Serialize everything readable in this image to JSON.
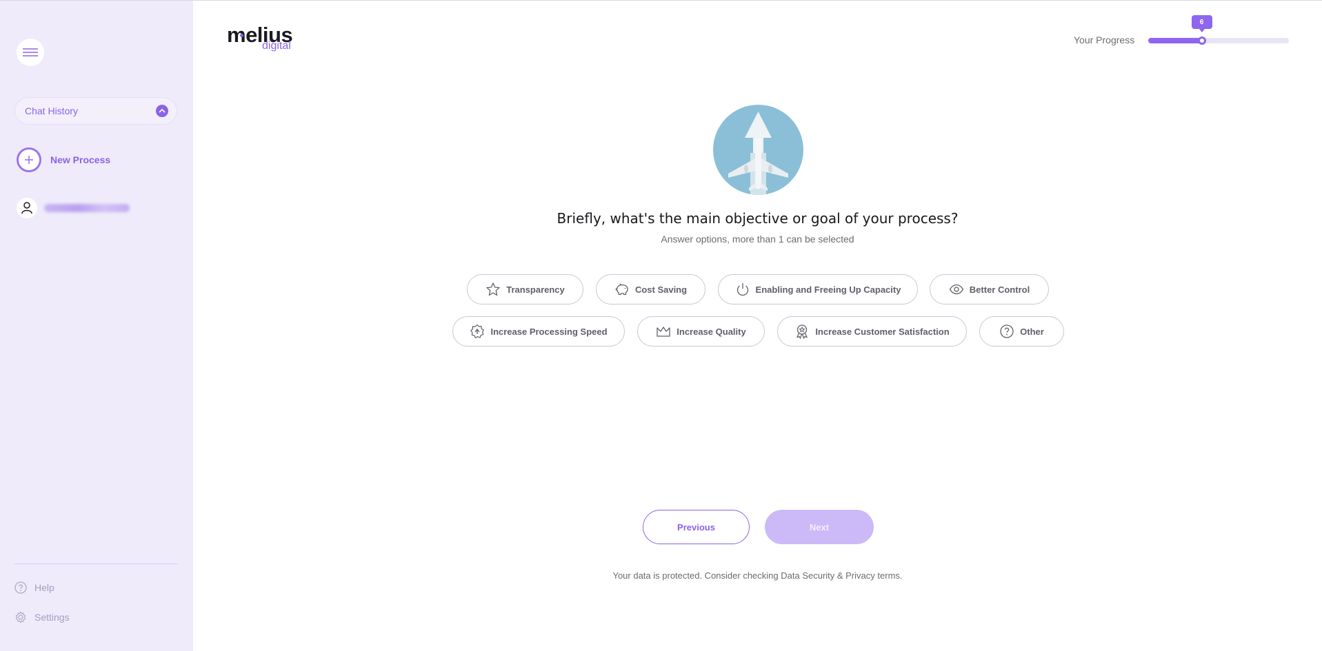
{
  "sidebar": {
    "chat_history_label": "Chat History",
    "new_process_label": "New Process",
    "help_label": "Help",
    "settings_label": "Settings"
  },
  "header": {
    "logo_primary": "melius",
    "logo_secondary": "digital",
    "progress_label": "Your Progress",
    "progress_value": "6",
    "progress_fraction": 0.38
  },
  "question": {
    "title": "Briefly, what's the main objective or goal of your process?",
    "hint": "Answer options, more than 1 can be selected"
  },
  "options": [
    {
      "label": "Transparency",
      "icon": "star-icon"
    },
    {
      "label": "Cost Saving",
      "icon": "piggy-bank-icon"
    },
    {
      "label": "Enabling and Freeing Up Capacity",
      "icon": "power-icon"
    },
    {
      "label": "Better Control",
      "icon": "eye-icon"
    },
    {
      "label": "Increase Processing Speed",
      "icon": "speed-badge-icon"
    },
    {
      "label": "Increase Quality",
      "icon": "crown-icon"
    },
    {
      "label": "Increase Customer Satisfaction",
      "icon": "award-icon"
    },
    {
      "label": "Other",
      "icon": "question-icon"
    }
  ],
  "navigation": {
    "previous_label": "Previous",
    "next_label": "Next"
  },
  "footer": {
    "note": "Your data is protected. Consider checking Data Security & Privacy terms."
  },
  "colors": {
    "accent": "#8a63e8",
    "sidebar_bg": "#efebfb",
    "next_disabled": "#cbbaf7"
  }
}
